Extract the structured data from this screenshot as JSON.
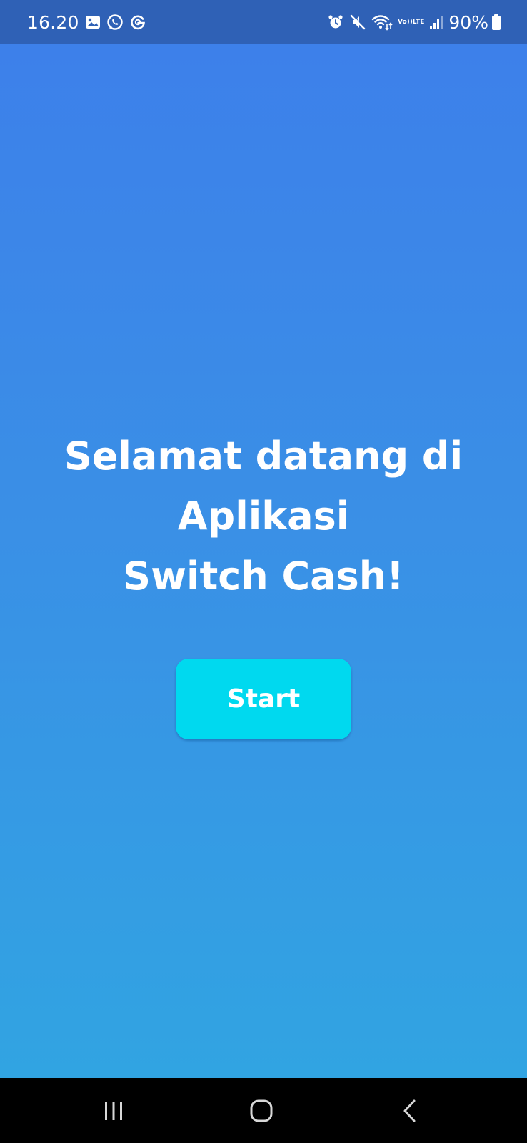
{
  "status_bar": {
    "time": "16.20",
    "battery_percent": "90%",
    "left_icons": [
      "gallery-icon",
      "whatsapp-icon",
      "g-icon"
    ],
    "right_icons": [
      "alarm-icon",
      "mute-icon",
      "wifi-icon",
      "volte-icon",
      "signal-icon",
      "battery-icon"
    ],
    "volte_label": "Vo))",
    "lte_label": "LTE",
    "battery_level": 0.9
  },
  "welcome": {
    "line1": "Selamat datang di",
    "line2": "Aplikasi",
    "line3": "Switch Cash!"
  },
  "start_button": {
    "label": "Start"
  },
  "colors": {
    "status_bar_bg": "#2f61b6",
    "gradient_top": "#3d80ea",
    "gradient_bottom": "#31a4e2",
    "button_bg": "#00d9ef",
    "text": "#ffffff",
    "nav_bar_bg": "#000000"
  },
  "nav_bar": {
    "buttons": [
      "recent-apps-icon",
      "home-icon",
      "back-icon"
    ]
  }
}
